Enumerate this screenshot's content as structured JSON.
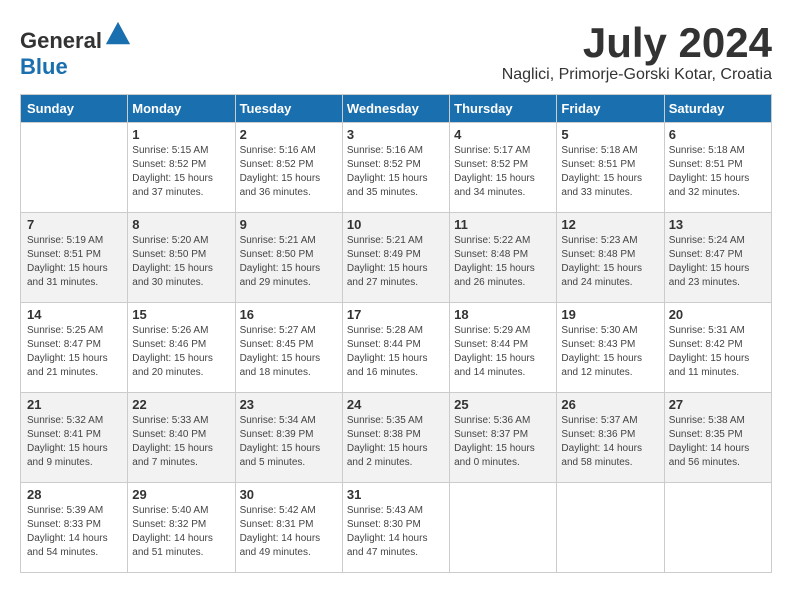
{
  "logo": {
    "general": "General",
    "blue": "Blue"
  },
  "title": {
    "month_year": "July 2024",
    "location": "Naglici, Primorje-Gorski Kotar, Croatia"
  },
  "headers": [
    "Sunday",
    "Monday",
    "Tuesday",
    "Wednesday",
    "Thursday",
    "Friday",
    "Saturday"
  ],
  "weeks": [
    [
      {
        "day": "",
        "info": ""
      },
      {
        "day": "1",
        "info": "Sunrise: 5:15 AM\nSunset: 8:52 PM\nDaylight: 15 hours\nand 37 minutes."
      },
      {
        "day": "2",
        "info": "Sunrise: 5:16 AM\nSunset: 8:52 PM\nDaylight: 15 hours\nand 36 minutes."
      },
      {
        "day": "3",
        "info": "Sunrise: 5:16 AM\nSunset: 8:52 PM\nDaylight: 15 hours\nand 35 minutes."
      },
      {
        "day": "4",
        "info": "Sunrise: 5:17 AM\nSunset: 8:52 PM\nDaylight: 15 hours\nand 34 minutes."
      },
      {
        "day": "5",
        "info": "Sunrise: 5:18 AM\nSunset: 8:51 PM\nDaylight: 15 hours\nand 33 minutes."
      },
      {
        "day": "6",
        "info": "Sunrise: 5:18 AM\nSunset: 8:51 PM\nDaylight: 15 hours\nand 32 minutes."
      }
    ],
    [
      {
        "day": "7",
        "info": "Sunrise: 5:19 AM\nSunset: 8:51 PM\nDaylight: 15 hours\nand 31 minutes."
      },
      {
        "day": "8",
        "info": "Sunrise: 5:20 AM\nSunset: 8:50 PM\nDaylight: 15 hours\nand 30 minutes."
      },
      {
        "day": "9",
        "info": "Sunrise: 5:21 AM\nSunset: 8:50 PM\nDaylight: 15 hours\nand 29 minutes."
      },
      {
        "day": "10",
        "info": "Sunrise: 5:21 AM\nSunset: 8:49 PM\nDaylight: 15 hours\nand 27 minutes."
      },
      {
        "day": "11",
        "info": "Sunrise: 5:22 AM\nSunset: 8:48 PM\nDaylight: 15 hours\nand 26 minutes."
      },
      {
        "day": "12",
        "info": "Sunrise: 5:23 AM\nSunset: 8:48 PM\nDaylight: 15 hours\nand 24 minutes."
      },
      {
        "day": "13",
        "info": "Sunrise: 5:24 AM\nSunset: 8:47 PM\nDaylight: 15 hours\nand 23 minutes."
      }
    ],
    [
      {
        "day": "14",
        "info": "Sunrise: 5:25 AM\nSunset: 8:47 PM\nDaylight: 15 hours\nand 21 minutes."
      },
      {
        "day": "15",
        "info": "Sunrise: 5:26 AM\nSunset: 8:46 PM\nDaylight: 15 hours\nand 20 minutes."
      },
      {
        "day": "16",
        "info": "Sunrise: 5:27 AM\nSunset: 8:45 PM\nDaylight: 15 hours\nand 18 minutes."
      },
      {
        "day": "17",
        "info": "Sunrise: 5:28 AM\nSunset: 8:44 PM\nDaylight: 15 hours\nand 16 minutes."
      },
      {
        "day": "18",
        "info": "Sunrise: 5:29 AM\nSunset: 8:44 PM\nDaylight: 15 hours\nand 14 minutes."
      },
      {
        "day": "19",
        "info": "Sunrise: 5:30 AM\nSunset: 8:43 PM\nDaylight: 15 hours\nand 12 minutes."
      },
      {
        "day": "20",
        "info": "Sunrise: 5:31 AM\nSunset: 8:42 PM\nDaylight: 15 hours\nand 11 minutes."
      }
    ],
    [
      {
        "day": "21",
        "info": "Sunrise: 5:32 AM\nSunset: 8:41 PM\nDaylight: 15 hours\nand 9 minutes."
      },
      {
        "day": "22",
        "info": "Sunrise: 5:33 AM\nSunset: 8:40 PM\nDaylight: 15 hours\nand 7 minutes."
      },
      {
        "day": "23",
        "info": "Sunrise: 5:34 AM\nSunset: 8:39 PM\nDaylight: 15 hours\nand 5 minutes."
      },
      {
        "day": "24",
        "info": "Sunrise: 5:35 AM\nSunset: 8:38 PM\nDaylight: 15 hours\nand 2 minutes."
      },
      {
        "day": "25",
        "info": "Sunrise: 5:36 AM\nSunset: 8:37 PM\nDaylight: 15 hours\nand 0 minutes."
      },
      {
        "day": "26",
        "info": "Sunrise: 5:37 AM\nSunset: 8:36 PM\nDaylight: 14 hours\nand 58 minutes."
      },
      {
        "day": "27",
        "info": "Sunrise: 5:38 AM\nSunset: 8:35 PM\nDaylight: 14 hours\nand 56 minutes."
      }
    ],
    [
      {
        "day": "28",
        "info": "Sunrise: 5:39 AM\nSunset: 8:33 PM\nDaylight: 14 hours\nand 54 minutes."
      },
      {
        "day": "29",
        "info": "Sunrise: 5:40 AM\nSunset: 8:32 PM\nDaylight: 14 hours\nand 51 minutes."
      },
      {
        "day": "30",
        "info": "Sunrise: 5:42 AM\nSunset: 8:31 PM\nDaylight: 14 hours\nand 49 minutes."
      },
      {
        "day": "31",
        "info": "Sunrise: 5:43 AM\nSunset: 8:30 PM\nDaylight: 14 hours\nand 47 minutes."
      },
      {
        "day": "",
        "info": ""
      },
      {
        "day": "",
        "info": ""
      },
      {
        "day": "",
        "info": ""
      }
    ]
  ]
}
